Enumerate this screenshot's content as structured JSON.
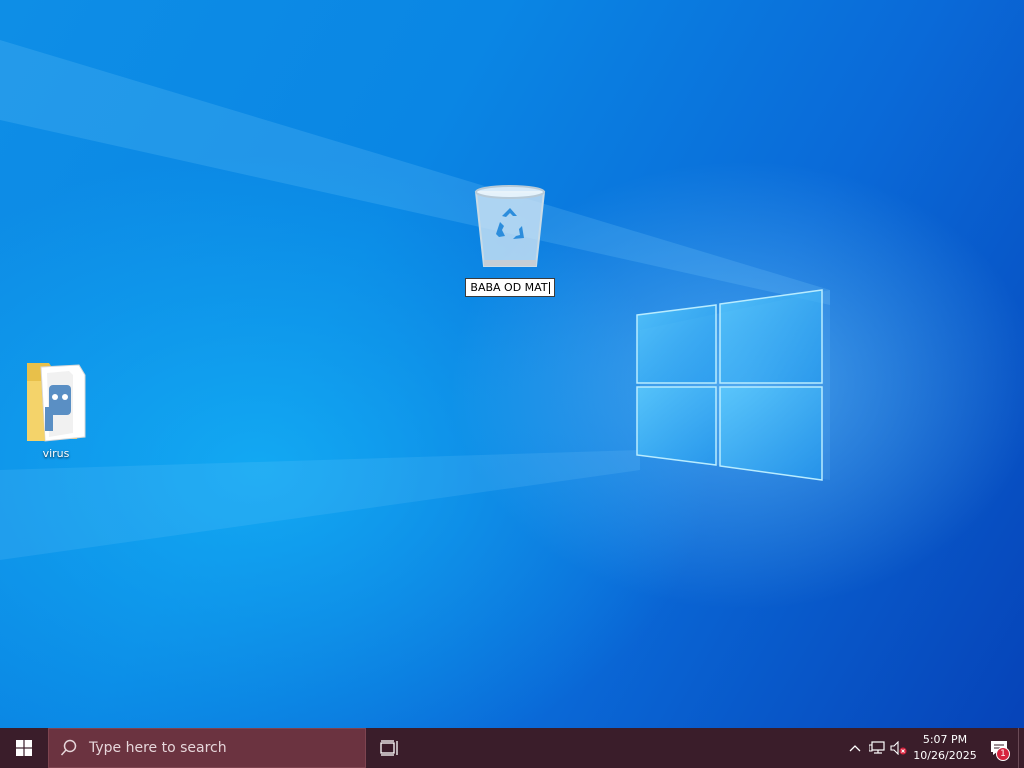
{
  "desktop": {
    "icons": [
      {
        "name": "recycle-bin",
        "label": "BABA OD MAT",
        "renaming": true
      },
      {
        "name": "virus-folder",
        "label": "virus",
        "renaming": false
      }
    ]
  },
  "taskbar": {
    "search_placeholder": "Type here to search",
    "time": "5:07 PM",
    "date": "10/26/2025",
    "notification_count": "1"
  },
  "colors": {
    "taskbar": "#3a1d2a",
    "search_box": "#6b3340",
    "desktop_accent": "#0a74d8"
  }
}
